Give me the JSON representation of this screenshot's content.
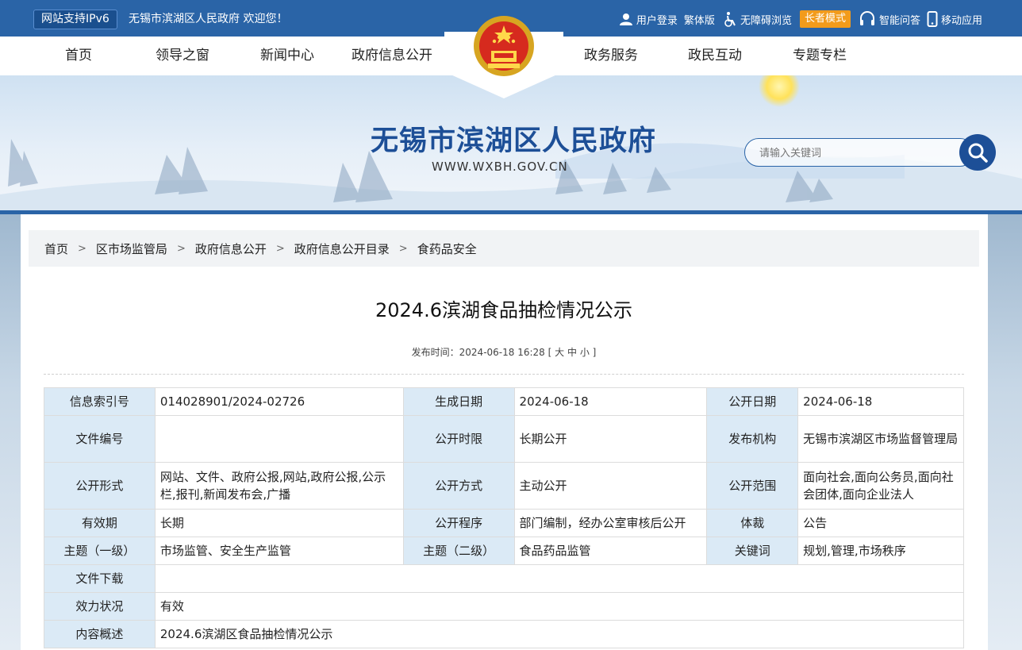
{
  "topbar": {
    "ipv6": "网站支持IPv6",
    "welcome": "无锡市滨湖区人民政府  欢迎您！",
    "login": "用户登录",
    "traditional": "繁体版",
    "accessible": "无障碍浏览",
    "elder_mode": "长者模式",
    "smart_qa": "智能问答",
    "mobile": "移动应用"
  },
  "nav": {
    "items": [
      "首页",
      "领导之窗",
      "新闻中心",
      "政府信息公开",
      "政务服务",
      "政民互动",
      "专题专栏"
    ]
  },
  "banner": {
    "title": "无锡市滨湖区人民政府",
    "url": "WWW.WXBH.GOV.CN",
    "search_placeholder": "请输入关键词"
  },
  "breadcrumb": [
    "首页",
    "区市场监管局",
    "政府信息公开",
    "政府信息公开目录",
    "食药品安全"
  ],
  "breadcrumb_sep": ">",
  "article": {
    "title": "2024.6滨湖食品抽检情况公示",
    "publish_label": "发布时间：",
    "publish_time": "2024-06-18 16:28",
    "font_open": "[",
    "font_large": "大",
    "font_mid": "中",
    "font_small": "小",
    "font_close": "]"
  },
  "info_table": {
    "index_label": "信息索引号",
    "index_value": "014028901/2024-02726",
    "gen_date_label": "生成日期",
    "gen_date_value": "2024-06-18",
    "pub_date_label": "公开日期",
    "pub_date_value": "2024-06-18",
    "doc_no_label": "文件编号",
    "doc_no_value": "",
    "pub_period_label": "公开时限",
    "pub_period_value": "长期公开",
    "org_label": "发布机构",
    "org_value": "无锡市滨湖区市场监督管理局",
    "form_label": "公开形式",
    "form_value": "网站、文件、政府公报,网站,政府公报,公示栏,报刊,新闻发布会,广播",
    "mode_label": "公开方式",
    "mode_value": "主动公开",
    "scope_label": "公开范围",
    "scope_value": "面向社会,面向公务员,面向社会团体,面向企业法人",
    "validity_label": "有效期",
    "validity_value": "长期",
    "procedure_label": "公开程序",
    "procedure_value": "部门编制，经办公室审核后公开",
    "genre_label": "体裁",
    "genre_value": "公告",
    "topic1_label": "主题（一级）",
    "topic1_value": "市场监管、安全生产监管",
    "topic2_label": "主题（二级）",
    "topic2_value": "食品药品监管",
    "keywords_label": "关键词",
    "keywords_value": "规划,管理,市场秩序",
    "download_label": "文件下载",
    "download_value": "",
    "status_label": "效力状况",
    "status_value": "有效",
    "summary_label": "内容概述",
    "summary_value": "2024.6滨湖区食品抽检情况公示"
  },
  "colors": {
    "brand_blue": "#2a64a7",
    "title_blue": "#1d4f97",
    "elder_orange": "#f29b1b",
    "table_key_bg": "#dbeaf6"
  },
  "icons": [
    "user-icon",
    "accessibility-icon",
    "headset-icon",
    "mobile-icon",
    "national-emblem-icon",
    "search-icon"
  ]
}
